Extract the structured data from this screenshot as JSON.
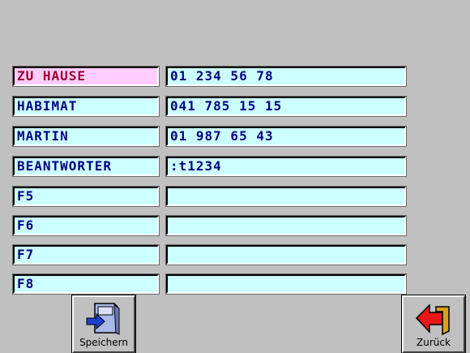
{
  "entries": [
    {
      "label": "ZU HAUSE",
      "value": "01 234 56 78"
    },
    {
      "label": "HABIMAT",
      "value": "041 785 15 15"
    },
    {
      "label": "MARTIN",
      "value": "01 987 65 43"
    },
    {
      "label": "BEANTWORTER",
      "value": ":t1234"
    },
    {
      "label": "F5",
      "value": ""
    },
    {
      "label": "F6",
      "value": ""
    },
    {
      "label": "F7",
      "value": ""
    },
    {
      "label": "F8",
      "value": ""
    }
  ],
  "buttons": {
    "save_label": "Speichern",
    "back_label": "Zurück"
  },
  "icons": {
    "save": "save-disk-icon",
    "back": "back-arrow-icon"
  },
  "colors": {
    "background": "#c0c0c0",
    "field": "#ccffff",
    "active_field": "#ffccff",
    "text": "#000080",
    "active_text": "#a00030"
  }
}
